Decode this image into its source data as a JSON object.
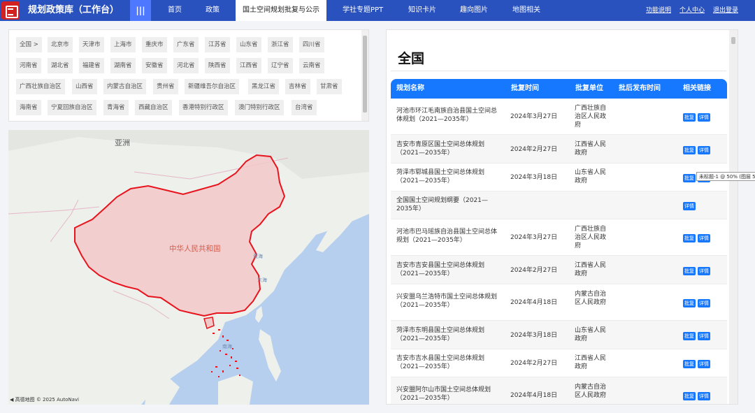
{
  "header": {
    "app_title": "规划政策库（工作台）",
    "grid_icon": "|||",
    "nav": [
      "首页",
      "政策",
      "国土空间规划批复与公示",
      "学社专题PPT",
      "知识卡片",
      "趣向图片",
      "地图相关"
    ],
    "right_links": [
      "功能说明",
      "个人中心",
      "退出登录"
    ]
  },
  "provinces": [
    "全国 >",
    "北京市",
    "天津市",
    "上海市",
    "重庆市",
    "广东省",
    "江苏省",
    "山东省",
    "浙江省",
    "四川省",
    "河南省",
    "湖北省",
    "福建省",
    "湖南省",
    "安徽省",
    "河北省",
    "陕西省",
    "江西省",
    "辽宁省",
    "云南省",
    "广西壮族自治区",
    "山西省",
    "内蒙古自治区",
    "贵州省",
    "新疆维吾尔自治区",
    "黑龙江省",
    "吉林省",
    "甘肃省",
    "海南省",
    "宁夏回族自治区",
    "青海省",
    "西藏自治区",
    "香港特别行政区",
    "澳门特别行政区",
    "台湾省"
  ],
  "map": {
    "continent_label": "亚洲",
    "country_label": "中华人民共和国",
    "seas": [
      "黄海",
      "东海",
      "南海"
    ],
    "attribution": "◀ 高德地图 © 2025 AutoNavi"
  },
  "panel": {
    "title": "全国",
    "columns": [
      "规划名称",
      "批复时间",
      "批复单位",
      "批后发布时间",
      "相关链接"
    ],
    "rows": [
      {
        "name": "河池市环江毛南族自治县国土空间总体规划（2021—2035年）",
        "date": "2024年3月27日",
        "unit": "广西壮族自治区人民政府",
        "pub": "",
        "links": [
          "批复",
          "详情"
        ]
      },
      {
        "name": "吉安市青原区国土空间总体规划（2021—2035年）",
        "date": "2024年2月27日",
        "unit": "江西省人民政府",
        "pub": "",
        "links": [
          "批复",
          "详情"
        ]
      },
      {
        "name": "菏泽市郓城县国土空间总体规划（2021—2035年）",
        "date": "2024年3月18日",
        "unit": "山东省人民政府",
        "pub": "",
        "links": [
          "批复",
          "详情"
        ]
      },
      {
        "name": "全国国土空间规划纲要（2021—2035年）",
        "date": "",
        "unit": "",
        "pub": "",
        "links": [
          "详情"
        ]
      },
      {
        "name": "河池市巴马瑶族自治县国土空间总体规划（2021—2035年）",
        "date": "2024年3月27日",
        "unit": "广西壮族自治区人民政府",
        "pub": "",
        "links": [
          "批复",
          "详情"
        ]
      },
      {
        "name": "吉安市吉安县国土空间总体规划（2021—2035年）",
        "date": "2024年2月27日",
        "unit": "江西省人民政府",
        "pub": "",
        "links": [
          "批复",
          "详情"
        ]
      },
      {
        "name": "兴安盟乌兰浩特市国土空间总体规划（2021—2035年）",
        "date": "2024年4月18日",
        "unit": "内蒙古自治区人民政府",
        "pub": "",
        "links": [
          "批复",
          "详情"
        ]
      },
      {
        "name": "菏泽市东明县国土空间总体规划（2021—2035年）",
        "date": "2024年3月18日",
        "unit": "山东省人民政府",
        "pub": "",
        "links": [
          "批复",
          "详情"
        ]
      },
      {
        "name": "吉安市吉水县国土空间总体规划（2021—2035年）",
        "date": "2024年2月27日",
        "unit": "江西省人民政府",
        "pub": "",
        "links": [
          "批复",
          "详情"
        ]
      },
      {
        "name": "兴安盟阿尔山市国土空间总体规划（2021—2035年）",
        "date": "2024年4月18日",
        "unit": "内蒙古自治区人民政府",
        "pub": "",
        "links": [
          "批复",
          "详情"
        ]
      }
    ]
  },
  "tooltip": "未标题-1 @ 50% (图层 5",
  "colors": {
    "topbar": "#2a52be",
    "accent": "#1677ff",
    "logo": "#d32020",
    "border": "#e8141d"
  }
}
